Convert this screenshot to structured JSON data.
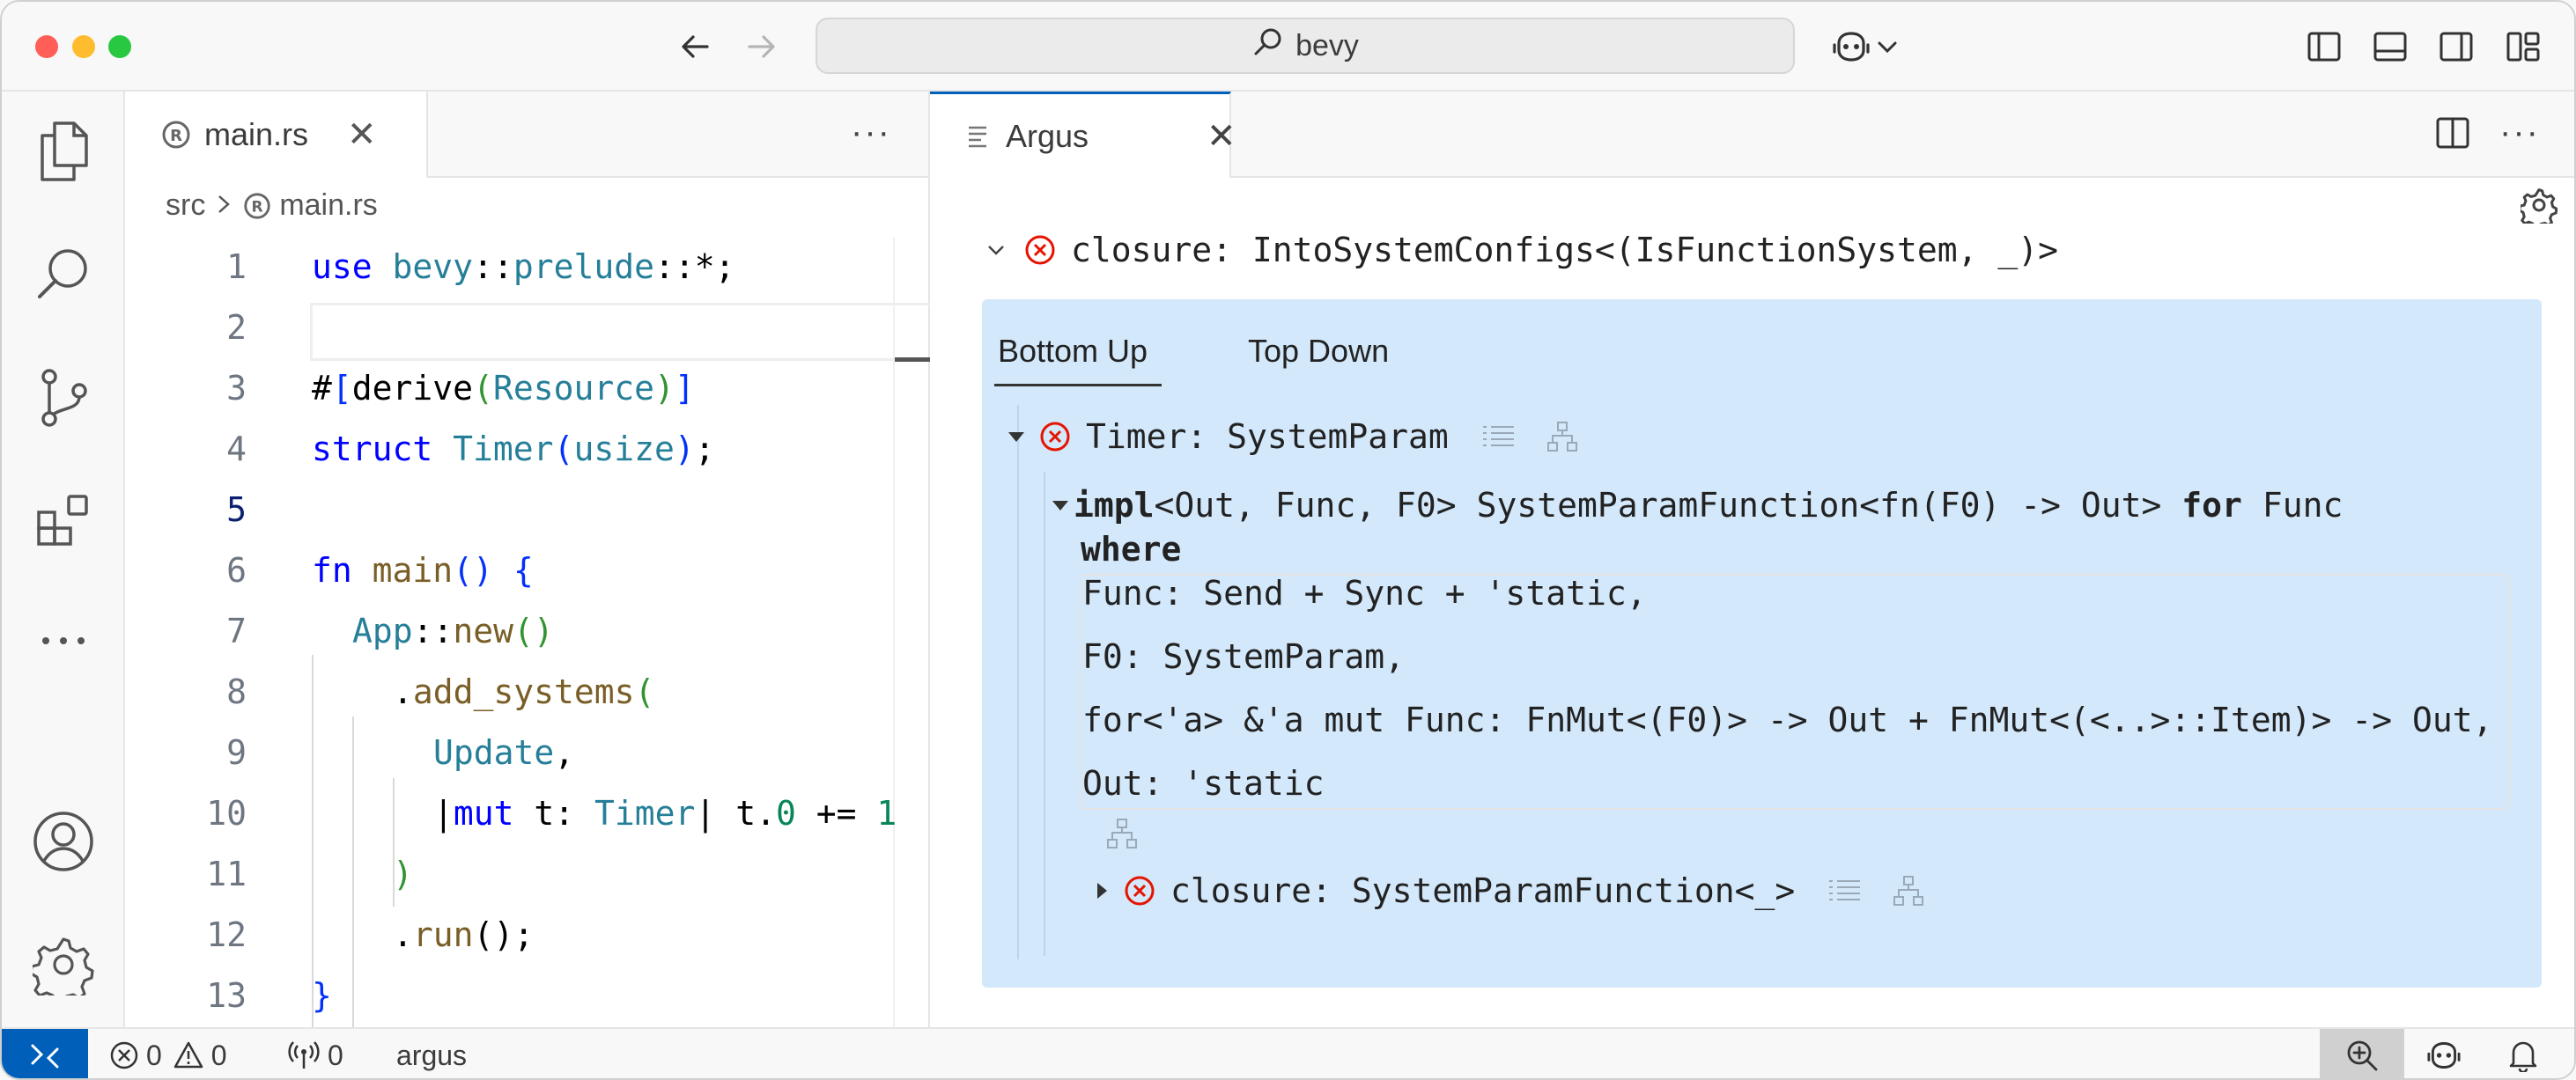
{
  "titlebar": {
    "search_text": "bevy"
  },
  "editor": {
    "tab_label": "main.rs",
    "breadcrumb": {
      "folder": "src",
      "file": "main.rs"
    },
    "lines": [
      {
        "n": "1"
      },
      {
        "n": "2"
      },
      {
        "n": "3"
      },
      {
        "n": "4"
      },
      {
        "n": "5"
      },
      {
        "n": "6"
      },
      {
        "n": "7"
      },
      {
        "n": "8"
      },
      {
        "n": "9"
      },
      {
        "n": "10"
      },
      {
        "n": "11"
      },
      {
        "n": "12"
      },
      {
        "n": "13"
      }
    ],
    "code": {
      "l1_use": "use",
      "l1_path_a": "bevy",
      "l1_sep": "::",
      "l1_path_b": "prelude",
      "l1_rest": "::*;",
      "l3_hash": "#",
      "l3_b1": "[",
      "l3_derive": "derive",
      "l3_p1": "(",
      "l3_res": "Resource",
      "l3_p2": ")",
      "l3_b2": "]",
      "l4_struct": "struct",
      "l4_timer": "Timer",
      "l4_p1": "(",
      "l4_usize": "usize",
      "l4_p2": ")",
      "l4_semi": ";",
      "l6_fn": "fn",
      "l6_main": "main",
      "l6_parens": "()",
      "l6_brace": "{",
      "l7_app": "App",
      "l7_sep": "::",
      "l7_new": "new",
      "l7_parens": "()",
      "l8_dot": ".",
      "l8_add": "add_systems",
      "l8_p": "(",
      "l9_update": "Update",
      "l9_comma": ",",
      "l10_bar1": "|",
      "l10_mut": "mut",
      "l10_t": " t: ",
      "l10_timer": "Timer",
      "l10_bar2": "|",
      "l10_expr": " t.",
      "l10_zero": "0",
      "l10_op": " += ",
      "l10_one": "1",
      "l11_p": ")",
      "l12_dot": ".",
      "l12_run": "run",
      "l12_rest": "();",
      "l13_brace": "}"
    }
  },
  "argus": {
    "tab_label": "Argus",
    "goal_text": "closure: IntoSystemConfigs<(IsFunctionSystem, _)>",
    "tabs": {
      "bottom_up": "Bottom Up",
      "top_down": "Top Down"
    },
    "node1": "Timer: SystemParam",
    "impl": {
      "kw_impl": "impl",
      "generics": "<Out, Func, F0> SystemParamFunction<fn(F0) -> Out> ",
      "kw_for": "for",
      "self_ty": " Func",
      "kw_where": "where",
      "where_clauses": [
        "Func: Send + Sync + 'static,",
        "F0: SystemParam,",
        "for<'a> &'a mut Func: FnMut<(F0)> -> Out + FnMut<(<..>::Item)> -> Out,",
        "Out: 'static"
      ]
    },
    "node2": "closure: SystemParamFunction<_>"
  },
  "statusbar": {
    "errors": "0",
    "warnings": "0",
    "ports": "0",
    "project": "argus"
  },
  "colors": {
    "accent": "#005fb8",
    "panel_bg": "#d3e8fb",
    "error": "#e51400"
  }
}
